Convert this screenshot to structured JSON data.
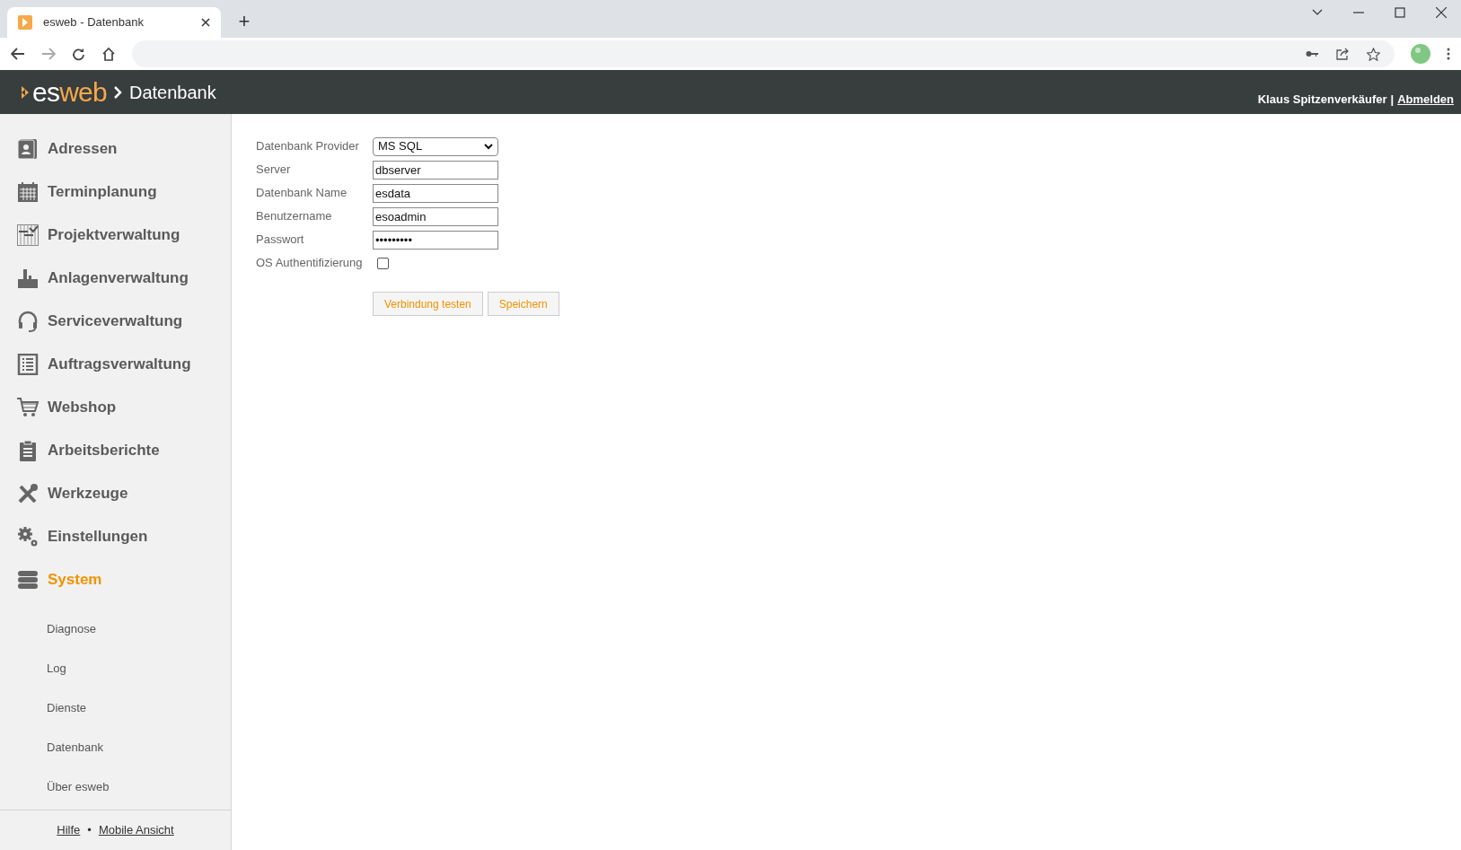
{
  "browser": {
    "tab_title": "esweb - Datenbank",
    "new_tab": "+"
  },
  "header": {
    "logo_part_1": "es",
    "logo_part_2": "web",
    "breadcrumb": "Datenbank",
    "user": "Klaus Spitzenverkäufer",
    "separator": "|",
    "logout": "Abmelden"
  },
  "sidebar": {
    "items": [
      {
        "label": "Adressen",
        "selected": false
      },
      {
        "label": "Terminplanung",
        "selected": false
      },
      {
        "label": "Projektverwaltung",
        "selected": false
      },
      {
        "label": "Anlagenverwaltung",
        "selected": false
      },
      {
        "label": "Serviceverwaltung",
        "selected": false
      },
      {
        "label": "Auftragsverwaltung",
        "selected": false
      },
      {
        "label": "Webshop",
        "selected": false
      },
      {
        "label": "Arbeitsberichte",
        "selected": false
      },
      {
        "label": "Werkzeuge",
        "selected": false
      },
      {
        "label": "Einstellungen",
        "selected": false
      },
      {
        "label": "System",
        "selected": true
      }
    ],
    "subitems": [
      "Diagnose",
      "Log",
      "Dienste",
      "Datenbank",
      "Über esweb"
    ],
    "footer": {
      "links": [
        "Hilfe",
        "Mobile Ansicht"
      ],
      "separator": "•"
    }
  },
  "form": {
    "fields": [
      {
        "label": "Datenbank Provider",
        "kind": "select",
        "value": "MS SQL"
      },
      {
        "label": "Server",
        "kind": "text",
        "value": "dbserver"
      },
      {
        "label": "Datenbank Name",
        "kind": "text",
        "value": "esdata"
      },
      {
        "label": "Benutzername",
        "kind": "text",
        "value": "esoadmin"
      },
      {
        "label": "Passwort",
        "kind": "text",
        "value": "•••••••••"
      },
      {
        "label": "OS Authentifizierung",
        "kind": "checkbox",
        "checked": false
      }
    ],
    "buttons": [
      "Verbindung testen",
      "Speichern"
    ]
  }
}
